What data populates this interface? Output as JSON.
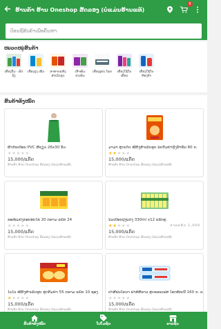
{
  "header": {
    "back_icon": "arrow-left-icon",
    "title": "ຮ້ານຄ້າ ຮ້ານ Oneshop ສັດລອງ (ບໍ່ແມ່ນຮ້ານແທ້)",
    "location_icon": "map-pin-icon",
    "cart_icon": "cart-icon",
    "cart_count": "8",
    "menu_icon": "more-vertical-icon"
  },
  "search": {
    "placeholder": "ປ້ອນຊື່ສິນຄ້າເພື່ອຄົ້ນຫາ"
  },
  "categories": {
    "title": "ໝວດໝູ່ສິນຄ້າ",
    "items": [
      {
        "label": "ເຄື່ອງດື່ມ - ຜັດຖົງ"
      },
      {
        "label": "ເຄື່ອງປຸງ ເສີມ"
      },
      {
        "label": "ອາຫານແຫ້ງ ສຳເລັດຮູບ"
      },
      {
        "label": "ເຂົ້າໜົມ ຂະໜົມ"
      },
      {
        "label": "ເຄື່ອງອຸປະ ໂພກ"
      },
      {
        "label": "ເຄື່ອງໃຊ້ໃນ ເຮືອນ"
      },
      {
        "label": "ເຄື່ອງໃຊ້ໃນ ຫ້ອງນ້ຳ"
      }
    ]
  },
  "products": {
    "title": "ສິນຄ້າທັງໝົດ",
    "items": [
      {
        "name": "ຜ້າກັນເປື້ອນ PVC ສີຂຽວ 26x30 ນິ້ວ",
        "stars": 0,
        "sold": "",
        "price": "15,000/ແກັດ",
        "shop": "ຮ້ານຄ້າ ຮ້ານ Oneshop ສັດລອງ (ບໍ່ແມ່ນຮ້ານແທ້)"
      },
      {
        "name": "ມາມ່າ ສູດເດັດ ໝີ່ກຶ່ງສຳເລັດຮູບ ລົດຕົ້ມຍຳກຸ້ງນ້ຳຂົ້ນ 80 ກ.",
        "stars": 2,
        "sold": "",
        "price": "15,000/ແກັດ",
        "shop": "ຮ້ານຄ້າ ຮ້ານ Oneshop ສັດລອງ (ບໍ່ແມ່ນຮ້ານແທ້)"
      },
      {
        "name": "ຂະໜົມປັງກອບອົບໄຂ່ 20 ກຣາມ ແພັກ 24",
        "stars": 0,
        "sold": "",
        "price": "15,000/ແກັດ",
        "shop": "ຮ້ານຄ້າ ຮ້ານ Oneshop ສັດລອງ (ບໍ່ແມ່ນຮ້ານແທ້)"
      },
      {
        "name": "ນົມເປົ້ອນປຸງແຕ່ງ 330ml x12 ແພັກຄູ່",
        "stars": 2,
        "sold": "ຂາຍແລ້ວ 1,000",
        "price": "15,000/ແກັດ",
        "shop": "ຮ້ານຄ້າ ຮ້ານ Oneshop ສັດລອງ (ບໍ່ແມ່ນຮ້ານແທ້)"
      },
      {
        "name": "ໄວໄວ ໝີ່ກຶ່ງສຳເລັດຮູບ ສູດຕົ້ມຍຳ 55 ກຣາມ ແພັກ 10 ຊອງ",
        "stars": 1,
        "sold": "",
        "price": "15,000/ແກັດ",
        "shop": "ຮ້ານຄ້າ ຮ້ານ Oneshop ສັດລອງ (ບໍ່ແມ່ນຮ້ານແທ້)"
      },
      {
        "name": "ຢາສີຟັນໂຄນາ ຟາສ໌ສີຂາວ ສູດຄອນເຟັສ ໂຮດທັກເນີ້ 160 ກ. ແພັກຄູ່",
        "stars": 0,
        "sold": "",
        "price": "15,000/ແກັດ",
        "shop": "ຮ້ານຄ້າ ຮ້ານ Oneshop ສັດລອງ (ບໍ່ແມ່ນຮ້ານແທ້)"
      }
    ]
  },
  "nav": {
    "items": [
      {
        "label": "ສິນຄ້າທັງໝົດ",
        "icon": "home-icon"
      },
      {
        "label": "ໂປໂມຊັນ",
        "icon": "tag-icon"
      },
      {
        "label": "ຂາວຊັ້ນ",
        "icon": "store-icon"
      }
    ]
  },
  "colors": {
    "brand": "#2e9d45",
    "badge": "#e53935",
    "star": "#f5b400"
  }
}
